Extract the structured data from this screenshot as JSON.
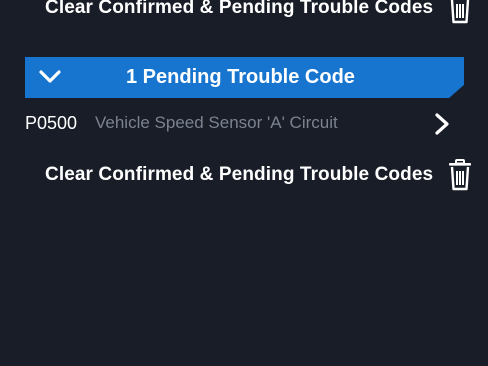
{
  "clear_top": {
    "label": "Clear Confirmed & Pending Trouble Codes",
    "icon": "trash-icon"
  },
  "pending": {
    "header_title": "1 Pending Trouble Code",
    "expanded": true,
    "header_color": "#1775cf",
    "icon": "chevron-down-icon",
    "codes": [
      {
        "code": "P0500",
        "description": "Vehicle Speed Sensor 'A' Circuit",
        "icon": "chevron-right-icon"
      }
    ]
  },
  "clear_bottom": {
    "label": "Clear Confirmed & Pending Trouble Codes",
    "icon": "trash-icon"
  },
  "colors": {
    "background": "#181d27",
    "text_primary": "#ffffff",
    "text_secondary": "#7c8290",
    "accent": "#1775cf"
  }
}
